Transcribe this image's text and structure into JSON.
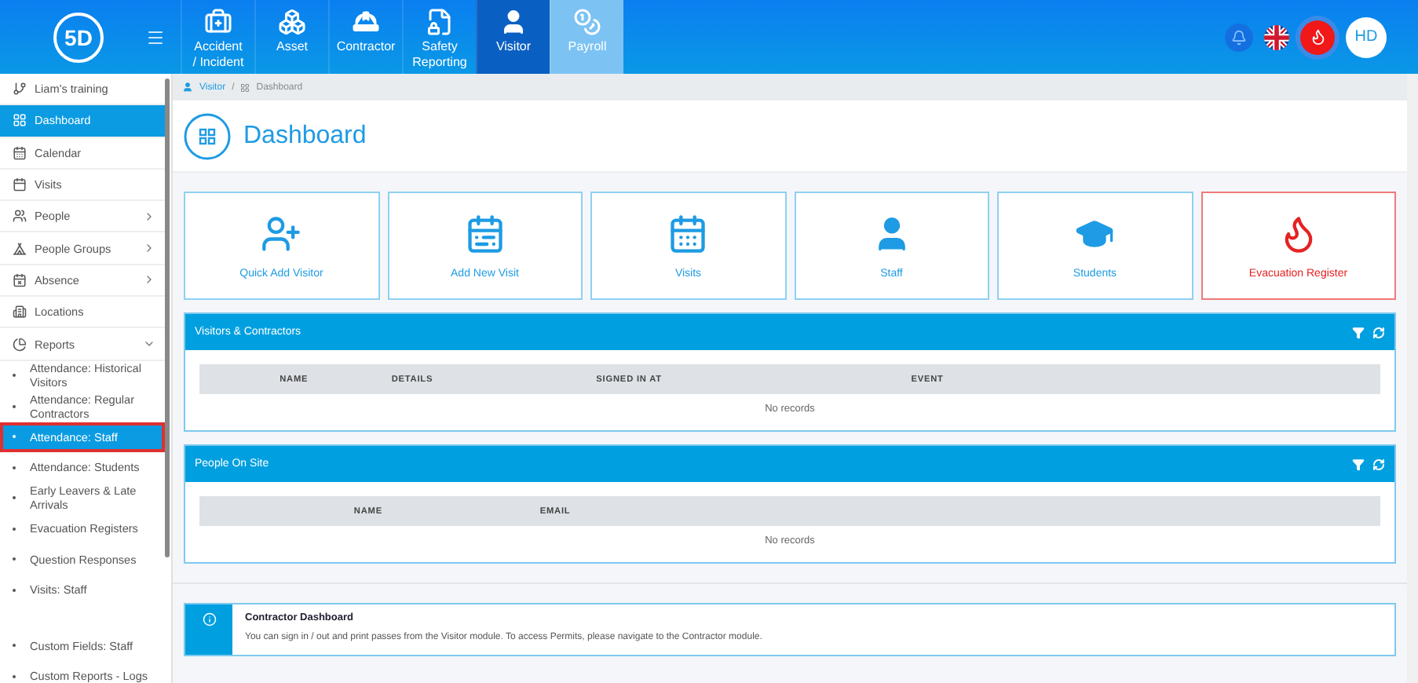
{
  "header": {
    "logo": "5D",
    "modules": [
      {
        "label": "Accident / Incident",
        "selected": false,
        "kind": "normal"
      },
      {
        "label": "Asset",
        "selected": false,
        "kind": "normal"
      },
      {
        "label": "Contractor",
        "selected": false,
        "kind": "normal"
      },
      {
        "label": "Safety Reporting",
        "selected": false,
        "kind": "normal"
      },
      {
        "label": "Visitor",
        "selected": true,
        "kind": "normal"
      },
      {
        "label": "Payroll",
        "selected": false,
        "kind": "light"
      }
    ],
    "avatar": "HD"
  },
  "sidebar": {
    "items": [
      {
        "label": "Liam's training",
        "kind": "top",
        "selected": false
      },
      {
        "label": "Dashboard",
        "kind": "top",
        "selected": true
      },
      {
        "label": "Calendar",
        "kind": "top",
        "selected": false
      },
      {
        "label": "Visits",
        "kind": "top",
        "selected": false
      },
      {
        "label": "People",
        "kind": "top",
        "selected": false,
        "expanded": false
      },
      {
        "label": "People Groups",
        "kind": "top",
        "selected": false,
        "expanded": false
      },
      {
        "label": "Absence",
        "kind": "top",
        "selected": false,
        "expanded": false
      },
      {
        "label": "Locations",
        "kind": "top",
        "selected": false
      },
      {
        "label": "Reports",
        "kind": "top",
        "selected": false,
        "expanded": true
      },
      {
        "label": "Attendance: Historical Visitors",
        "kind": "sub",
        "selected": false
      },
      {
        "label": "Attendance: Regular Contractors",
        "kind": "sub",
        "selected": false
      },
      {
        "label": "Attendance: Staff",
        "kind": "sub",
        "selected": true,
        "outlined": true
      },
      {
        "label": "Attendance: Students",
        "kind": "sub",
        "selected": false
      },
      {
        "label": "Early Leavers & Late Arrivals",
        "kind": "sub",
        "selected": false
      },
      {
        "label": "Evacuation Registers",
        "kind": "sub",
        "selected": false
      },
      {
        "label": "Question Responses",
        "kind": "sub",
        "selected": false
      },
      {
        "label": "Visits: Staff",
        "kind": "sub",
        "selected": false
      },
      {
        "kind": "divider"
      },
      {
        "label": "Custom Fields: Staff",
        "kind": "sub",
        "selected": false
      },
      {
        "label": "Custom Reports - Logs",
        "kind": "sub",
        "selected": false
      }
    ]
  },
  "breadcrumb": {
    "items": [
      "Visitor",
      "Dashboard"
    ],
    "separator": "/"
  },
  "page_title": "Dashboard",
  "tiles": [
    {
      "label": "Quick Add Visitor",
      "kind": "normal"
    },
    {
      "label": "Add New Visit",
      "kind": "normal"
    },
    {
      "label": "Visits",
      "kind": "normal"
    },
    {
      "label": "Staff",
      "kind": "normal"
    },
    {
      "label": "Students",
      "kind": "normal"
    },
    {
      "label": "Evacuation Register",
      "kind": "alert"
    }
  ],
  "panels": [
    {
      "title": "Visitors & Contractors",
      "columns": [
        "NAME",
        "DETAILS",
        "SIGNED IN AT",
        "EVENT"
      ],
      "empty": "No records"
    },
    {
      "title": "People On Site",
      "columns": [
        "NAME",
        "EMAIL"
      ],
      "empty": "No records"
    }
  ],
  "info": {
    "title": "Contractor Dashboard",
    "text": "You can sign in / out and print passes from the Visitor module. To access Permits, please navigate to the Contractor module."
  }
}
